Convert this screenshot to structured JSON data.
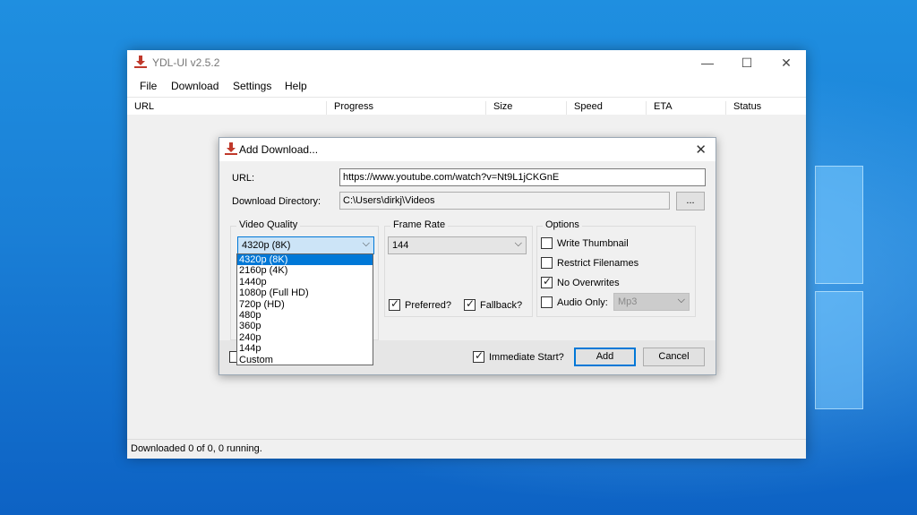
{
  "main_window": {
    "title": "YDL-UI v2.5.2",
    "controls": {
      "minimize": "—",
      "maximize": "☐",
      "close": "✕"
    },
    "menu": [
      "File",
      "Download",
      "Settings",
      "Help"
    ],
    "columns": [
      "URL",
      "Progress",
      "Size",
      "Speed",
      "ETA",
      "Status"
    ],
    "status": "Downloaded 0 of 0, 0 running."
  },
  "dialog": {
    "title": "Add Download...",
    "close": "✕",
    "url_label": "URL:",
    "url_value": "https://www.youtube.com/watch?v=Nt9L1jCKGnE",
    "dir_label": "Download Directory:",
    "dir_value": "C:\\Users\\dirkj\\Videos",
    "browse_label": "...",
    "video_quality": {
      "title": "Video Quality",
      "selected": "4320p (8K)",
      "options": [
        "4320p (8K)",
        "2160p (4K)",
        "1440p",
        "1080p (Full HD)",
        "720p (HD)",
        "480p",
        "360p",
        "240p",
        "144p",
        "Custom"
      ]
    },
    "frame_rate": {
      "title": "Frame Rate",
      "selected": "144",
      "preferred_label": "Preferred?",
      "fallback_label": "Fallback?",
      "preferred_checked": true,
      "fallback_checked": true
    },
    "options": {
      "title": "Options",
      "write_thumbnail": "Write Thumbnail",
      "restrict_filenames": "Restrict Filenames",
      "no_overwrites": "No Overwrites",
      "audio_only": "Audio Only:",
      "audio_format": "Mp3",
      "write_thumbnail_checked": false,
      "restrict_filenames_checked": false,
      "no_overwrites_checked": true,
      "audio_only_checked": false
    },
    "immediate_start_label": "Immediate Start?",
    "immediate_start_checked": true,
    "add_label": "Add",
    "cancel_label": "Cancel"
  },
  "colors": {
    "accent": "#0078d7",
    "icon_red": "#c0392b"
  }
}
